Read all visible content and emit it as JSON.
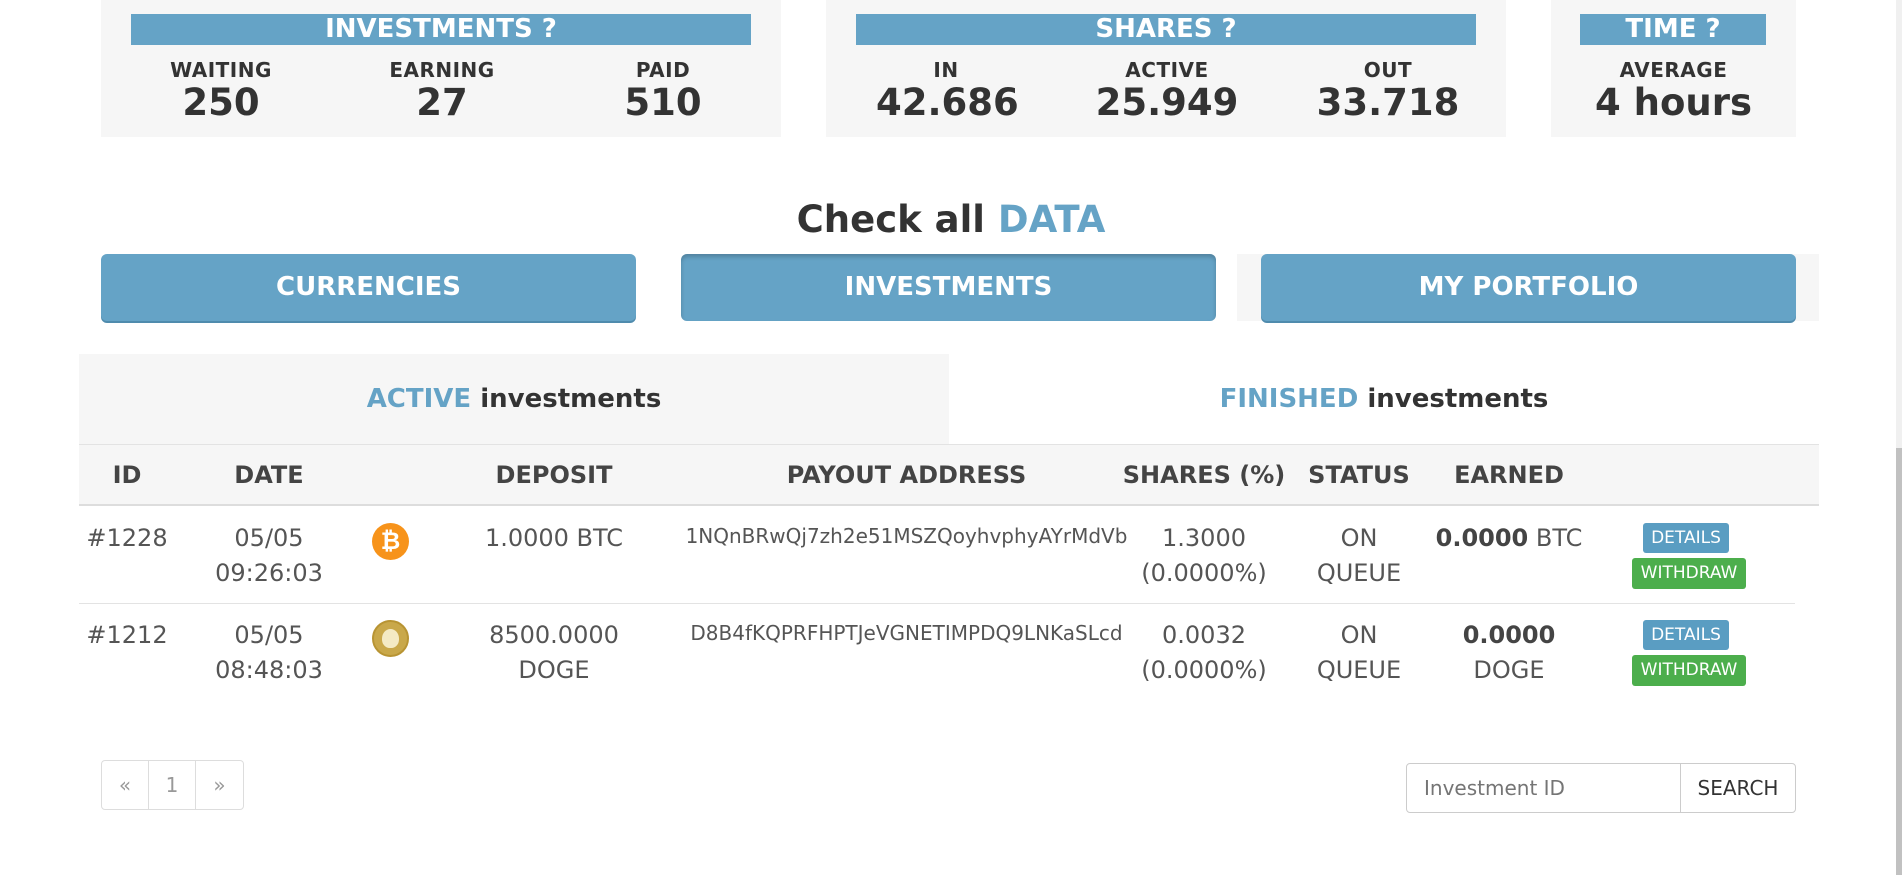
{
  "stats": {
    "investments": {
      "title": "INVESTMENTS ?",
      "cols": [
        {
          "label": "WAITING",
          "value": "250"
        },
        {
          "label": "EARNING",
          "value": "27"
        },
        {
          "label": "PAID",
          "value": "510"
        }
      ]
    },
    "shares": {
      "title": "SHARES ?",
      "cols": [
        {
          "label": "IN",
          "value": "42.686"
        },
        {
          "label": "ACTIVE",
          "value": "25.949"
        },
        {
          "label": "OUT",
          "value": "33.718"
        }
      ]
    },
    "time": {
      "title": "TIME ?",
      "cols": [
        {
          "label": "AVERAGE",
          "value": "4 hours"
        }
      ]
    }
  },
  "heading": {
    "prefix": "Check all",
    "accent": "DATA"
  },
  "nav_buttons": [
    "CURRENCIES",
    "INVESTMENTS",
    "MY PORTFOLIO"
  ],
  "tabs": [
    {
      "accent": "ACTIVE",
      "rest": "investments"
    },
    {
      "accent": "FINISHED",
      "rest": "investments"
    }
  ],
  "table": {
    "headers": [
      "ID",
      "DATE",
      "DEPOSIT",
      "PAYOUT ADDRESS",
      "SHARES (%)",
      "STATUS",
      "EARNED"
    ],
    "rows": [
      {
        "id": "#1228",
        "date": "05/05",
        "time": "09:26:03",
        "coin": "btc-coin-icon",
        "deposit_amount": "1.0000 BTC",
        "deposit_unit": "",
        "address": "1NQnBRwQj7zh2e51MSZQoyhvphyAYrMdVb",
        "shares": "1.3000",
        "shares_pct": "(0.0000%)",
        "status1": "ON",
        "status2": "QUEUE",
        "earned": "0.0000",
        "earned_unit": "BTC",
        "details": "DETAILS",
        "withdraw": "WITHDRAW"
      },
      {
        "id": "#1212",
        "date": "05/05",
        "time": "08:48:03",
        "coin": "doge-coin-icon",
        "deposit_amount": "8500.0000",
        "deposit_unit": "DOGE",
        "address": "D8B4fKQPRFHPTJeVGNETIMPDQ9LNKaSLcd",
        "shares": "0.0032",
        "shares_pct": "(0.0000%)",
        "status1": "ON",
        "status2": "QUEUE",
        "earned": "0.0000",
        "earned_unit": "DOGE",
        "details": "DETAILS",
        "withdraw": "WITHDRAW"
      }
    ]
  },
  "pagination": {
    "prev": "«",
    "page": "1",
    "next": "»"
  },
  "search": {
    "placeholder": "Investment ID",
    "button": "SEARCH"
  },
  "colors": {
    "accent": "#65a3c6",
    "success": "#4cae4c",
    "btc": "#f7931a"
  }
}
